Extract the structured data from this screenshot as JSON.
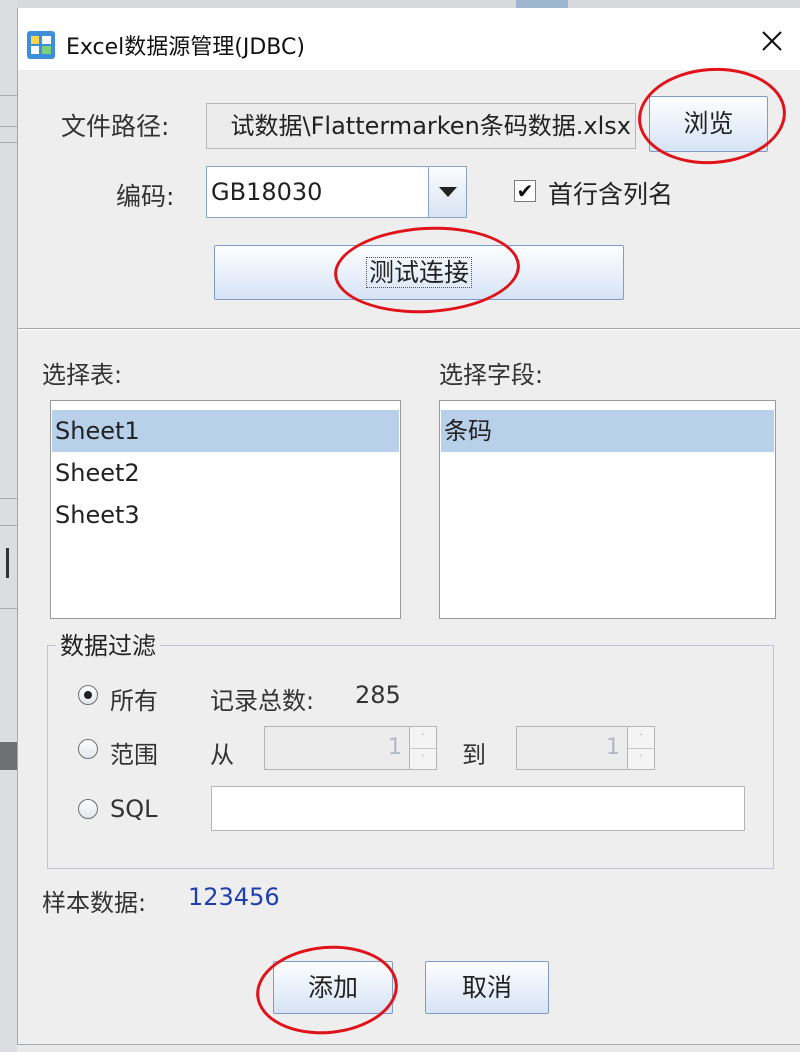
{
  "window": {
    "title": "Excel数据源管理(JDBC)",
    "icon": "database-sheet-icon",
    "close_icon": "close-icon"
  },
  "file": {
    "label": "文件路径:",
    "path": "试数据\\Flattermarken条码数据.xlsx",
    "browse_label": "浏览"
  },
  "encoding": {
    "label": "编码:",
    "value": "GB18030",
    "first_row_header_label": "首行含列名",
    "first_row_header_checked": true
  },
  "test_connection_label": "测试连接",
  "select_table": {
    "label": "选择表:",
    "items": [
      "Sheet1",
      "Sheet2",
      "Sheet3"
    ],
    "selected": "Sheet1"
  },
  "select_field": {
    "label": "选择字段:",
    "items": [
      "条码"
    ],
    "selected": "条码"
  },
  "filter": {
    "title": "数据过滤",
    "all_label": "所有",
    "record_total_label": "记录总数:",
    "record_total": "285",
    "range_label": "范围",
    "from_label": "从",
    "from_value": "1",
    "to_label": "到",
    "to_value": "1",
    "sql_label": "SQL",
    "sql_value": "",
    "selected": "all"
  },
  "sample": {
    "label": "样本数据:",
    "value": "123456"
  },
  "buttons": {
    "add_label": "添加",
    "cancel_label": "取消"
  },
  "colors": {
    "annotation": "#e0121a",
    "sample_value": "#1f3fb0",
    "selection": "#b9d0ea"
  }
}
